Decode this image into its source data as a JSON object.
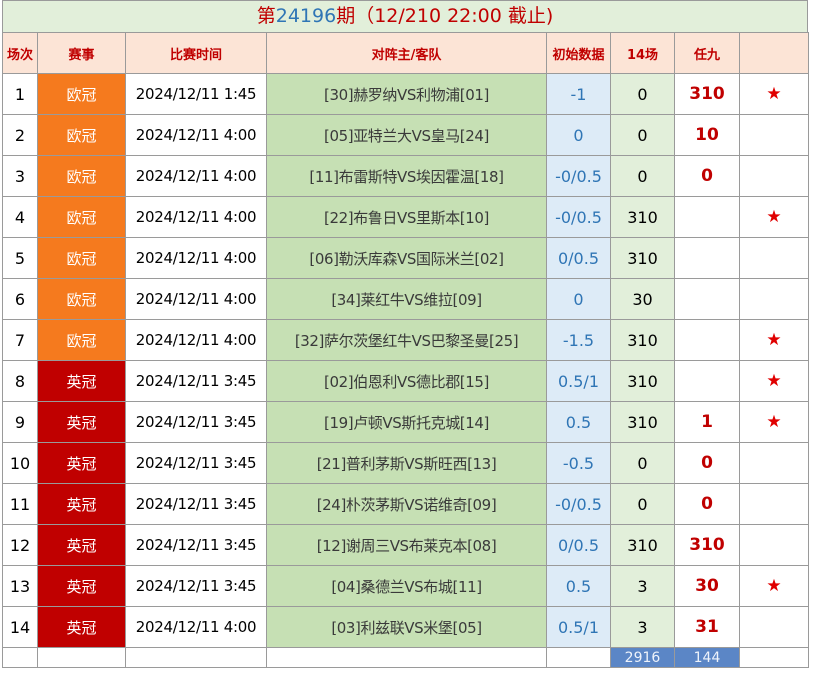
{
  "title": {
    "prefix": "第",
    "issue": "24196",
    "suffix": "期（12/210 22:00 截止)"
  },
  "headers": {
    "index": "场次",
    "league": "赛事",
    "time": "比赛时间",
    "match": "对阵主/客队",
    "odds": "初始数据",
    "s14": "14场",
    "r9": "任九",
    "mark": ""
  },
  "rows": [
    {
      "index": "1",
      "league": "欧冠",
      "time": "2024/12/11 1:45",
      "match": "[30]赫罗纳VS利物浦[01]",
      "odds": "-1",
      "s14": "0",
      "r9": "310",
      "mark": "★"
    },
    {
      "index": "2",
      "league": "欧冠",
      "time": "2024/12/11 4:00",
      "match": "[05]亚特兰大VS皇马[24]",
      "odds": "0",
      "s14": "0",
      "r9": "10",
      "mark": ""
    },
    {
      "index": "3",
      "league": "欧冠",
      "time": "2024/12/11 4:00",
      "match": "[11]布雷斯特VS埃因霍温[18]",
      "odds": "-0/0.5",
      "s14": "0",
      "r9": "0",
      "mark": ""
    },
    {
      "index": "4",
      "league": "欧冠",
      "time": "2024/12/11 4:00",
      "match": "[22]布鲁日VS里斯本[10]",
      "odds": "-0/0.5",
      "s14": "310",
      "r9": "",
      "mark": "★"
    },
    {
      "index": "5",
      "league": "欧冠",
      "time": "2024/12/11 4:00",
      "match": "[06]勒沃库森VS国际米兰[02]",
      "odds": "0/0.5",
      "s14": "310",
      "r9": "",
      "mark": ""
    },
    {
      "index": "6",
      "league": "欧冠",
      "time": "2024/12/11 4:00",
      "match": "[34]莱红牛VS维拉[09]",
      "odds": "0",
      "s14": "30",
      "r9": "",
      "mark": ""
    },
    {
      "index": "7",
      "league": "欧冠",
      "time": "2024/12/11 4:00",
      "match": "[32]萨尔茨堡红牛VS巴黎圣曼[25]",
      "odds": "-1.5",
      "s14": "310",
      "r9": "",
      "mark": "★"
    },
    {
      "index": "8",
      "league": "英冠",
      "time": "2024/12/11 3:45",
      "match": "[02]伯恩利VS德比郡[15]",
      "odds": "0.5/1",
      "s14": "310",
      "r9": "",
      "mark": "★"
    },
    {
      "index": "9",
      "league": "英冠",
      "time": "2024/12/11 3:45",
      "match": "[19]卢顿VS斯托克城[14]",
      "odds": "0.5",
      "s14": "310",
      "r9": "1",
      "mark": "★"
    },
    {
      "index": "10",
      "league": "英冠",
      "time": "2024/12/11 3:45",
      "match": "[21]普利茅斯VS斯旺西[13]",
      "odds": "-0.5",
      "s14": "0",
      "r9": "0",
      "mark": ""
    },
    {
      "index": "11",
      "league": "英冠",
      "time": "2024/12/11 3:45",
      "match": "[24]朴茨茅斯VS诺维奇[09]",
      "odds": "-0/0.5",
      "s14": "0",
      "r9": "0",
      "mark": ""
    },
    {
      "index": "12",
      "league": "英冠",
      "time": "2024/12/11 3:45",
      "match": "[12]谢周三VS布莱克本[08]",
      "odds": "0/0.5",
      "s14": "310",
      "r9": "310",
      "mark": ""
    },
    {
      "index": "13",
      "league": "英冠",
      "time": "2024/12/11 3:45",
      "match": "[04]桑德兰VS布城[11]",
      "odds": "0.5",
      "s14": "3",
      "r9": "30",
      "mark": "★"
    },
    {
      "index": "14",
      "league": "英冠",
      "time": "2024/12/11 4:00",
      "match": "[03]利兹联VS米堡[05]",
      "odds": "0.5/1",
      "s14": "3",
      "r9": "31",
      "mark": ""
    }
  ],
  "totals": {
    "s14": "2916",
    "r9": "144"
  },
  "colors": {
    "league_ucl": "#f57a1e",
    "league_championship": "#c00000",
    "match_bg": "#c6e0b4",
    "odds_bg": "#ddebf7",
    "header_bg": "#fce4d6",
    "title_bg": "#e2efda",
    "accent_red": "#c00000",
    "accent_blue": "#2f75b5"
  }
}
